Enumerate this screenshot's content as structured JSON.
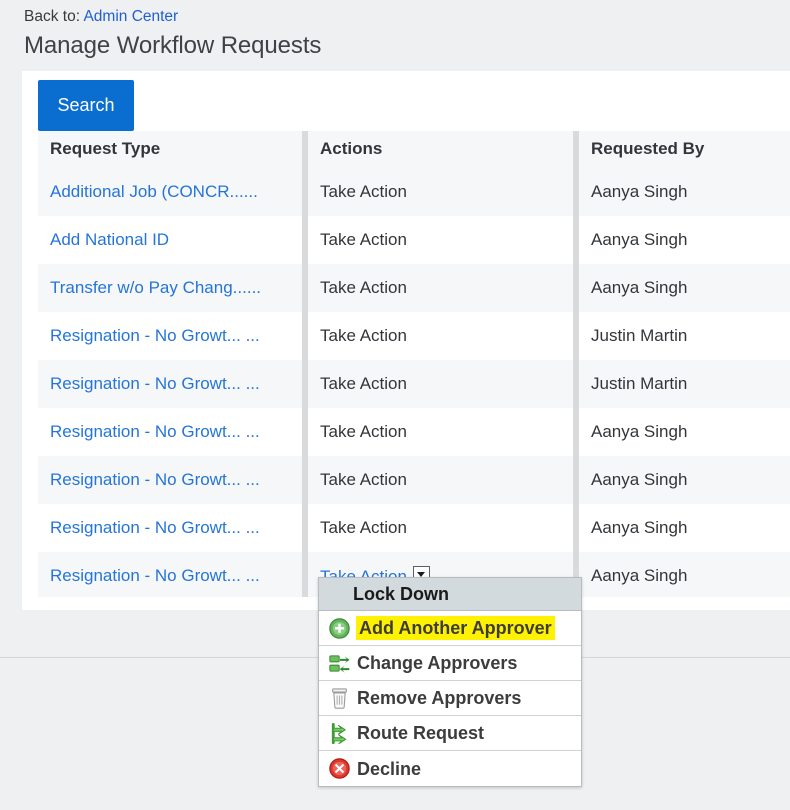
{
  "breadcrumb": {
    "label": "Back to:",
    "link_text": "Admin Center"
  },
  "page_title": "Manage Workflow Requests",
  "toolbar": {
    "search_label": "Search"
  },
  "table": {
    "columns": [
      "Request Type",
      "Actions",
      "Requested By"
    ],
    "rows": [
      {
        "request_type": "Additional Job (CONCR......",
        "action": "Take Action",
        "requested_by": "Aanya Singh",
        "action_is_link": false
      },
      {
        "request_type": "Add National ID",
        "action": "Take Action",
        "requested_by": "Aanya Singh",
        "action_is_link": false
      },
      {
        "request_type": "Transfer w/o Pay Chang......",
        "action": "Take Action",
        "requested_by": "Aanya Singh",
        "action_is_link": false
      },
      {
        "request_type": "Resignation - No Growt... ...",
        "action": "Take Action",
        "requested_by": "Justin Martin",
        "action_is_link": false
      },
      {
        "request_type": "Resignation - No Growt... ...",
        "action": "Take Action",
        "requested_by": "Justin Martin",
        "action_is_link": false
      },
      {
        "request_type": "Resignation - No Growt... ...",
        "action": "Take Action",
        "requested_by": "Aanya Singh",
        "action_is_link": false
      },
      {
        "request_type": "Resignation - No Growt... ...",
        "action": "Take Action",
        "requested_by": "Aanya Singh",
        "action_is_link": false
      },
      {
        "request_type": "Resignation - No Growt... ...",
        "action": "Take Action",
        "requested_by": "Aanya Singh",
        "action_is_link": false
      },
      {
        "request_type": "Resignation - No Growt... ...",
        "action": "Take Action",
        "requested_by": "Aanya Singh",
        "action_is_link": true
      }
    ]
  },
  "dropdown_menu": {
    "header": "Lock Down",
    "items": [
      {
        "label": "Add Another Approver",
        "icon": "add-circle-icon",
        "highlighted": true
      },
      {
        "label": "Change Approvers",
        "icon": "swap-arrows-icon",
        "highlighted": false
      },
      {
        "label": "Remove Approvers",
        "icon": "trash-icon",
        "highlighted": false
      },
      {
        "label": "Route Request",
        "icon": "route-arrow-icon",
        "highlighted": false
      },
      {
        "label": "Decline",
        "icon": "decline-circle-icon",
        "highlighted": false
      }
    ]
  },
  "colors": {
    "page_background": "#eff0f1",
    "card_background": "#ffffff",
    "link": "#2575d8",
    "primary_button": "#0a6ed1",
    "menu_header_background": "#d2dade",
    "highlight": "#fff200",
    "row_stripe": "#f6f7f8"
  }
}
